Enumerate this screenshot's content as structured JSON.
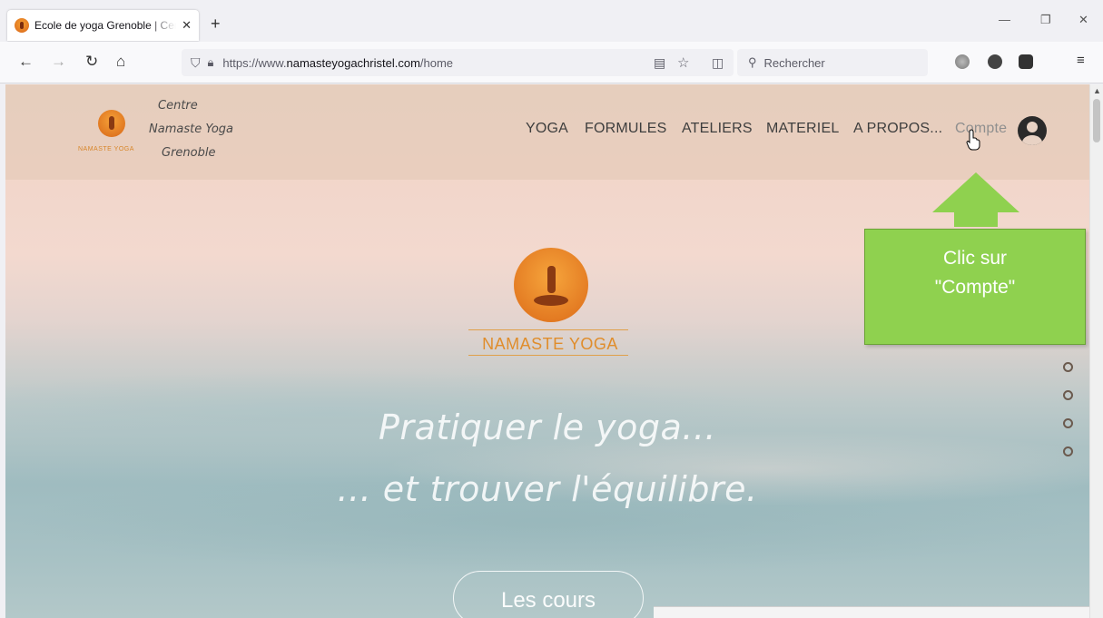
{
  "browser": {
    "tab_title": "Ecole de yoga Grenoble | Centre Namaste Yoga Grenoble",
    "url_prefix": "https://www.",
    "url_domain": "namasteyogachristel.com",
    "url_path": "/home",
    "search_placeholder": "Rechercher"
  },
  "site": {
    "name_line1": "Centre",
    "name_line2": "Namaste Yoga",
    "name_line3": "Grenoble",
    "logo_small_text": "NAMASTE YOGA",
    "menu": [
      "YOGA",
      "FORMULES",
      "ATELIERS",
      "MATERIEL",
      "A PROPOS...",
      "Compte"
    ],
    "hero_brand": "NAMASTE YOGA",
    "slogan_line1": "Pratiquer le yoga...",
    "slogan_line2": "... et trouver l'équilibre.",
    "cta_label": "Les cours"
  },
  "annotation": {
    "line1": "Clic sur",
    "line2": "\"Compte\"",
    "color": "#8fd14f"
  }
}
